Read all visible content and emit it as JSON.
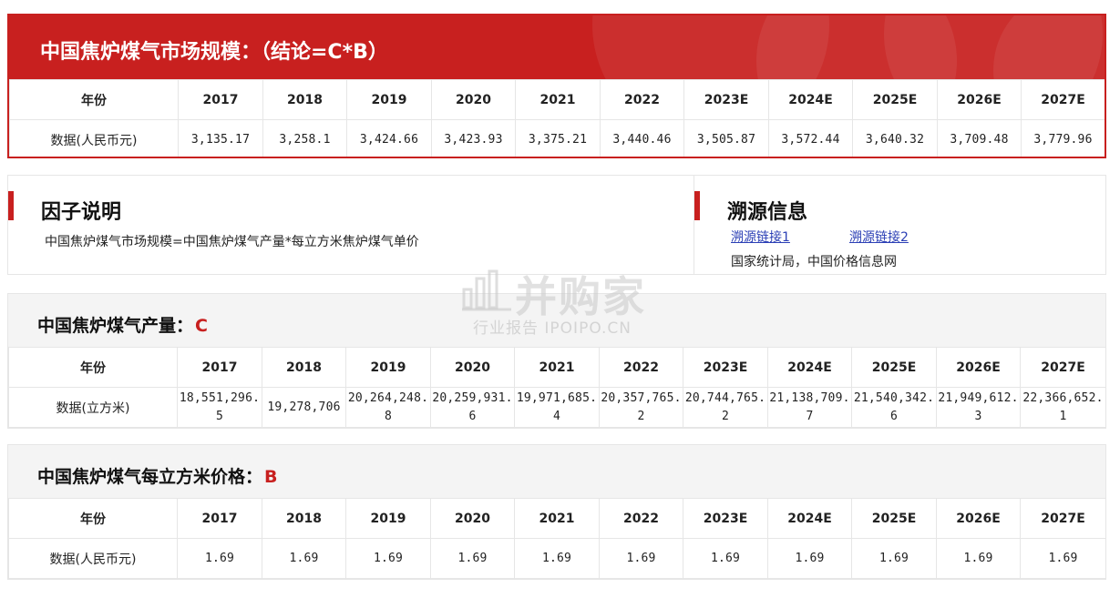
{
  "market_size": {
    "title": "中国焦炉煤气市场规模：（结论=C*B）",
    "header_label": "年份",
    "row_label": "数据(人民币元)",
    "years": [
      "2017",
      "2018",
      "2019",
      "2020",
      "2021",
      "2022",
      "2023E",
      "2024E",
      "2025E",
      "2026E",
      "2027E"
    ],
    "values": [
      "3,135.17",
      "3,258.1",
      "3,424.66",
      "3,423.93",
      "3,375.21",
      "3,440.46",
      "3,505.87",
      "3,572.44",
      "3,640.32",
      "3,709.48",
      "3,779.96"
    ]
  },
  "factor": {
    "heading": "因子说明",
    "text": "中国焦炉煤气市场规模=中国焦炉煤气产量*每立方米焦炉煤气单价"
  },
  "source": {
    "heading": "溯源信息",
    "link1": "溯源链接1",
    "link2": "溯源链接2",
    "text": "国家统计局，中国价格信息网"
  },
  "production": {
    "title": "中国焦炉煤气产量：",
    "code": "C",
    "header_label": "年份",
    "row_label": "数据(立方米)",
    "years": [
      "2017",
      "2018",
      "2019",
      "2020",
      "2021",
      "2022",
      "2023E",
      "2024E",
      "2025E",
      "2026E",
      "2027E"
    ],
    "values": [
      "18,551,296.5",
      "19,278,706",
      "20,264,248.8",
      "20,259,931.6",
      "19,971,685.4",
      "20,357,765.2",
      "20,744,765.2",
      "21,138,709.7",
      "21,540,342.6",
      "21,949,612.3",
      "22,366,652.1"
    ]
  },
  "price": {
    "title": "中国焦炉煤气每立方米价格：",
    "code": "B",
    "header_label": "年份",
    "row_label": "数据(人民币元)",
    "years": [
      "2017",
      "2018",
      "2019",
      "2020",
      "2021",
      "2022",
      "2023E",
      "2024E",
      "2025E",
      "2026E",
      "2027E"
    ],
    "values": [
      "1.69",
      "1.69",
      "1.69",
      "1.69",
      "1.69",
      "1.69",
      "1.69",
      "1.69",
      "1.69",
      "1.69",
      "1.69"
    ]
  },
  "watermark": {
    "brand": "并购家",
    "sub": "行业报告 IPOIPO.CN"
  },
  "colors": {
    "accent_red": "#c8201f",
    "link_blue": "#2b3fb5",
    "section_bg": "#f4f4f4",
    "border": "#e6e6e6"
  }
}
